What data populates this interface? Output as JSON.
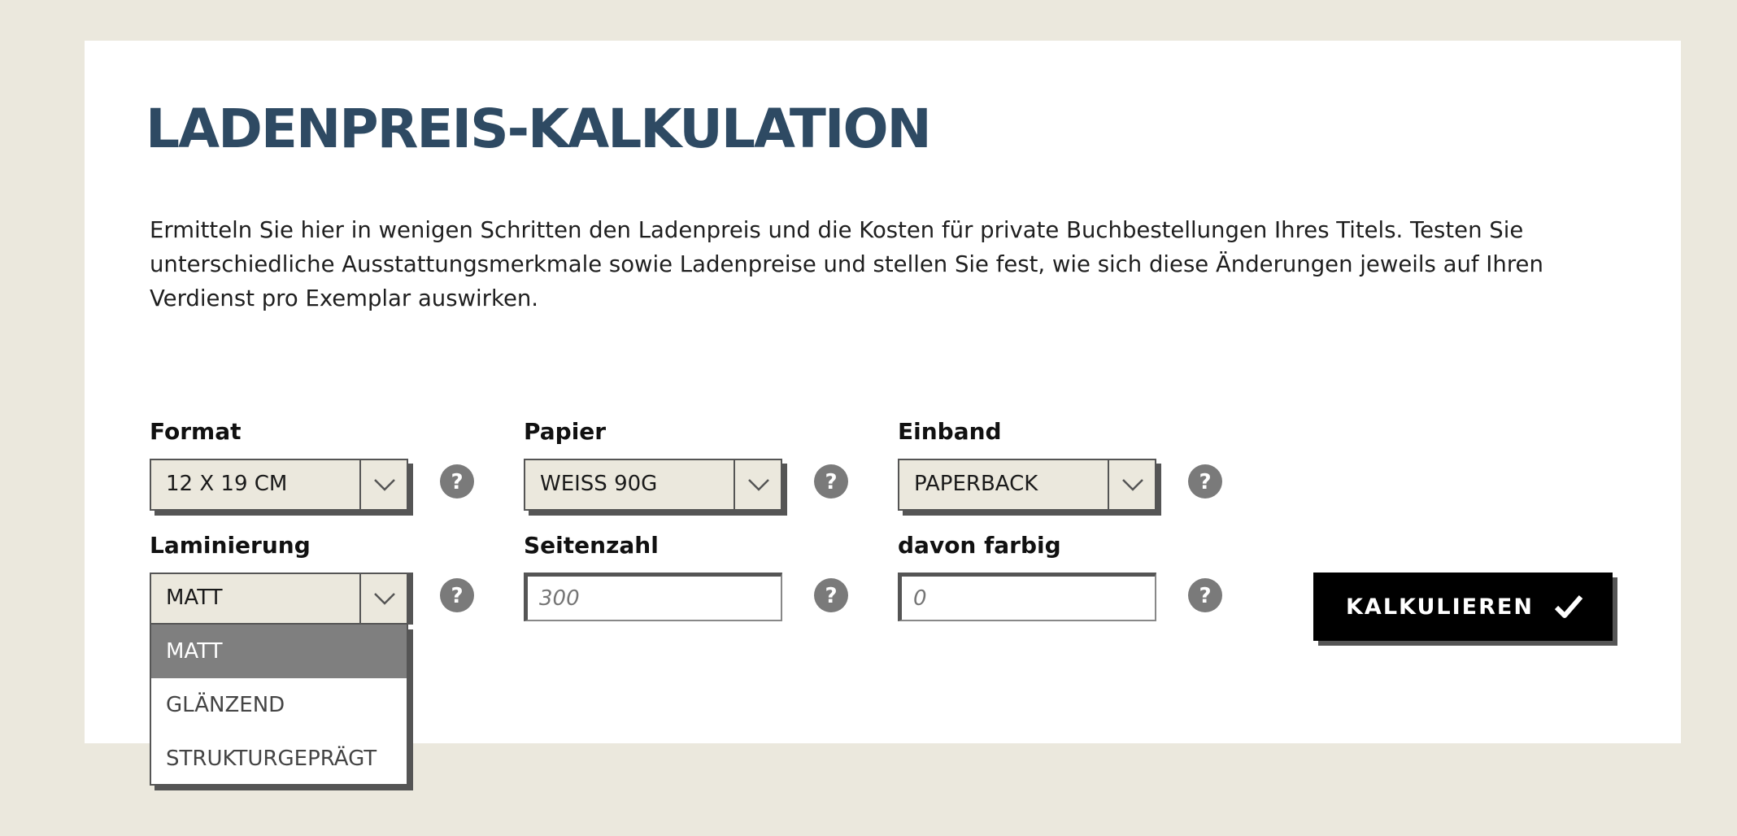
{
  "page": {
    "title": "LADENPREIS-KALKULATION",
    "intro": "Ermitteln Sie hier in wenigen Schritten den Ladenpreis und die Kosten für private Buchbestellungen Ihres Titels. Testen Sie unterschiedliche Ausstattungsmerkmale sowie Ladenpreise und stellen Sie fest, wie sich diese Änderungen jeweils auf Ihren Verdienst pro Exemplar auswirken."
  },
  "form": {
    "format": {
      "label": "Format",
      "value": "12 X 19 CM"
    },
    "papier": {
      "label": "Papier",
      "value": "WEISS 90G"
    },
    "einband": {
      "label": "Einband",
      "value": "PAPERBACK"
    },
    "laminierung": {
      "label": "Laminierung",
      "value": "MATT",
      "options": [
        "MATT",
        "GLÄNZEND",
        "STRUKTURGEPRÄGT"
      ]
    },
    "seitenzahl": {
      "label": "Seitenzahl",
      "placeholder": "300"
    },
    "farbig": {
      "label": "davon farbig",
      "placeholder": "0"
    },
    "submit_label": "KALKULIEREN"
  },
  "colors": {
    "background": "#ebe8dd",
    "title": "#2e4a63",
    "select_bg": "#ebe8dd",
    "help_icon": "#7a7a7a",
    "option_active": "#7f7f7f",
    "button_bg": "#000000"
  },
  "icons": {
    "select_arrow": "chevron-down-icon",
    "help": "help-icon",
    "submit": "checkmark-icon"
  }
}
